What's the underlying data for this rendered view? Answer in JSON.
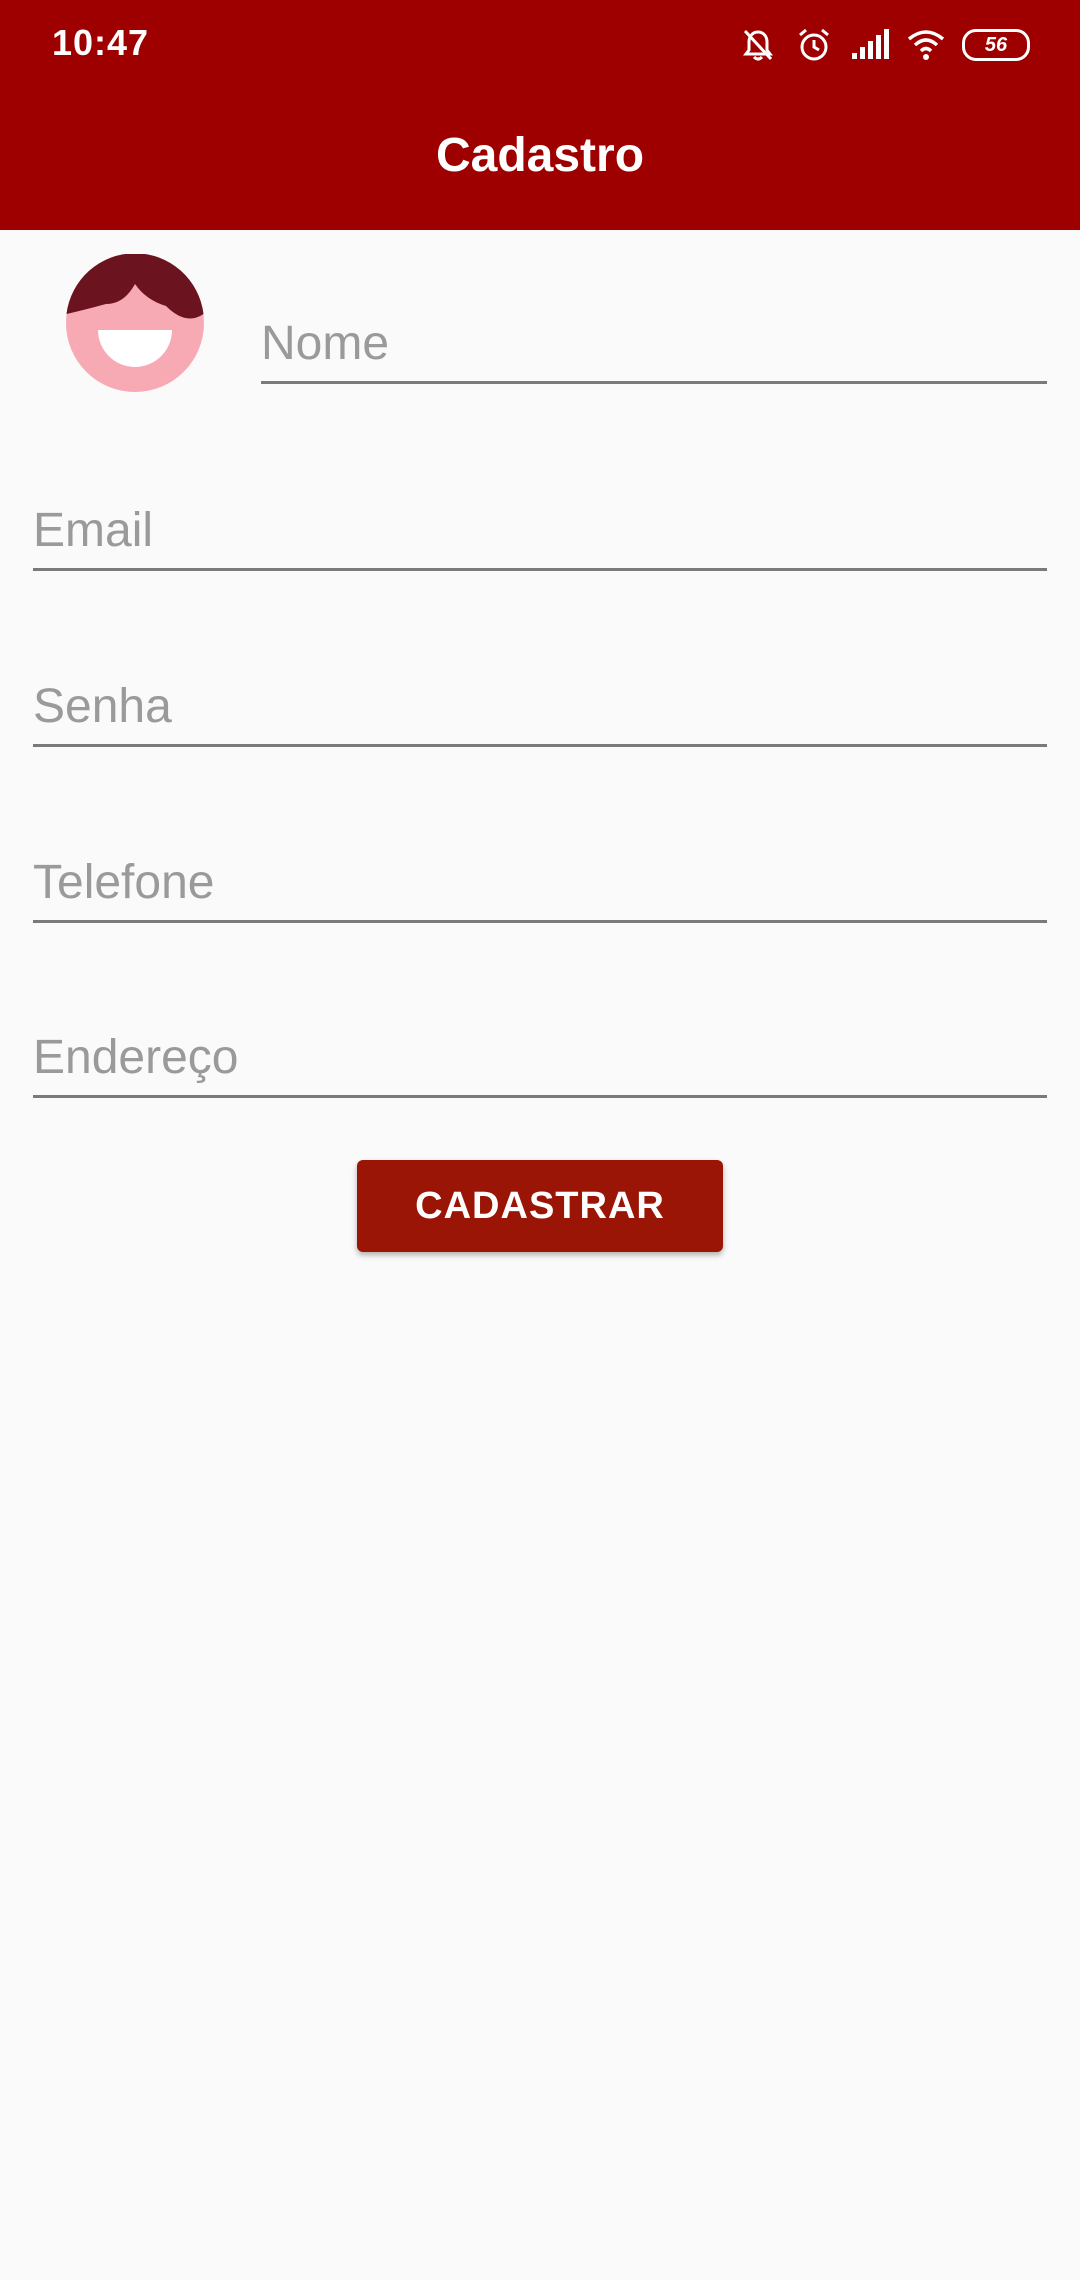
{
  "status_bar": {
    "time": "10:47",
    "battery": "56"
  },
  "app_bar": {
    "title": "Cadastro"
  },
  "form": {
    "nome": {
      "placeholder": "Nome",
      "value": ""
    },
    "email": {
      "placeholder": "Email",
      "value": ""
    },
    "senha": {
      "placeholder": "Senha",
      "value": ""
    },
    "telefone": {
      "placeholder": "Telefone",
      "value": ""
    },
    "endereco": {
      "placeholder": "Endereço",
      "value": ""
    },
    "submit_label": "CADASTRAR"
  },
  "colors": {
    "primary": "#9e0000",
    "button": "#9a1506",
    "avatar_face": "#f7aab4",
    "avatar_hair": "#6b1420"
  },
  "icons": [
    "silent-icon",
    "alarm-icon",
    "signal-icon",
    "wifi-icon",
    "battery-icon",
    "avatar-icon"
  ]
}
